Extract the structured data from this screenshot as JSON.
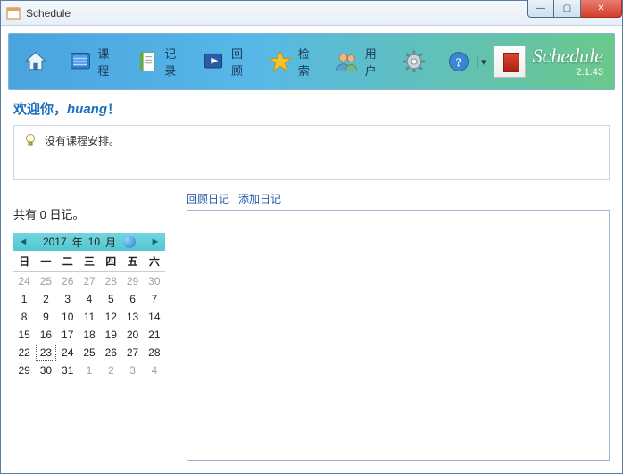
{
  "window": {
    "title": "Schedule"
  },
  "win_controls": {
    "min": "—",
    "max": "▢",
    "close": "✕"
  },
  "toolbar": {
    "items": [
      {
        "name": "home",
        "label": "",
        "icon": "home-icon"
      },
      {
        "name": "courses",
        "label": "课程",
        "icon": "courses-icon"
      },
      {
        "name": "records",
        "label": "记录",
        "icon": "records-icon"
      },
      {
        "name": "review",
        "label": "回顾",
        "icon": "review-icon"
      },
      {
        "name": "search",
        "label": "检索",
        "icon": "search-icon"
      },
      {
        "name": "users",
        "label": "用户",
        "icon": "users-icon"
      },
      {
        "name": "settings",
        "label": "",
        "icon": "gear-icon"
      },
      {
        "name": "help",
        "label": "",
        "icon": "help-icon"
      }
    ]
  },
  "brand": {
    "name": "Schedule",
    "version": "2.1.43"
  },
  "welcome": {
    "prefix": "欢迎你，",
    "user": "huang",
    "suffix": "！"
  },
  "notice": {
    "text": "没有课程安排。"
  },
  "diary": {
    "count_prefix": "共有 ",
    "count": "0",
    "count_suffix": " 日记。",
    "link_review": "回顾日记",
    "link_add": "添加日记"
  },
  "calendar": {
    "header_year_label": "年",
    "header_month_label": "月",
    "year": "2017",
    "month": "10",
    "dow": [
      "日",
      "一",
      "二",
      "三",
      "四",
      "五",
      "六"
    ],
    "today": 23,
    "rows": [
      [
        {
          "d": 24,
          "o": true
        },
        {
          "d": 25,
          "o": true
        },
        {
          "d": 26,
          "o": true
        },
        {
          "d": 27,
          "o": true
        },
        {
          "d": 28,
          "o": true
        },
        {
          "d": 29,
          "o": true
        },
        {
          "d": 30,
          "o": true
        }
      ],
      [
        {
          "d": 1
        },
        {
          "d": 2
        },
        {
          "d": 3
        },
        {
          "d": 4
        },
        {
          "d": 5
        },
        {
          "d": 6
        },
        {
          "d": 7
        }
      ],
      [
        {
          "d": 8
        },
        {
          "d": 9
        },
        {
          "d": 10
        },
        {
          "d": 11
        },
        {
          "d": 12
        },
        {
          "d": 13
        },
        {
          "d": 14
        }
      ],
      [
        {
          "d": 15
        },
        {
          "d": 16
        },
        {
          "d": 17
        },
        {
          "d": 18
        },
        {
          "d": 19
        },
        {
          "d": 20
        },
        {
          "d": 21
        }
      ],
      [
        {
          "d": 22
        },
        {
          "d": 23
        },
        {
          "d": 24
        },
        {
          "d": 25
        },
        {
          "d": 26
        },
        {
          "d": 27
        },
        {
          "d": 28
        }
      ],
      [
        {
          "d": 29
        },
        {
          "d": 30
        },
        {
          "d": 31
        },
        {
          "d": 1,
          "o": true
        },
        {
          "d": 2,
          "o": true
        },
        {
          "d": 3,
          "o": true
        },
        {
          "d": 4,
          "o": true
        }
      ]
    ]
  }
}
